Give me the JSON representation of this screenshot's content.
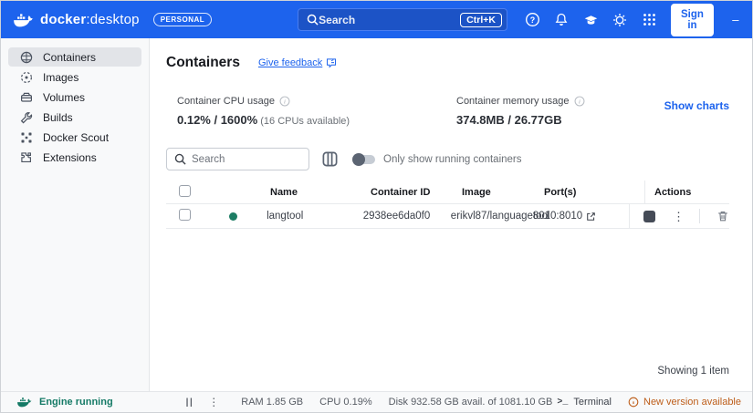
{
  "titlebar": {
    "brand_bold": "docker",
    "brand_sep": ":",
    "brand_light": "desktop",
    "plan_badge": "PERSONAL",
    "search_placeholder": "Search",
    "shortcut": "Ctrl+K",
    "sign_in_label": "Sign in",
    "minimize": "–",
    "close": "✕"
  },
  "sidebar": {
    "items": [
      {
        "label": "Containers"
      },
      {
        "label": "Images"
      },
      {
        "label": "Volumes"
      },
      {
        "label": "Builds"
      },
      {
        "label": "Docker Scout"
      },
      {
        "label": "Extensions"
      }
    ]
  },
  "main": {
    "title": "Containers",
    "feedback_link": "Give feedback",
    "stats": {
      "cpu_label": "Container CPU usage",
      "cpu_value": "0.12% / 1600%",
      "cpu_note": " (16 CPUs available)",
      "mem_label": "Container memory usage",
      "mem_value": "374.8MB / 26.77GB",
      "show_charts": "Show charts"
    },
    "controls": {
      "search_placeholder": "Search",
      "toggle_label": "Only show running containers"
    },
    "table": {
      "headers": [
        "Name",
        "Container ID",
        "Image",
        "Port(s)",
        "Actions"
      ],
      "rows": [
        {
          "name": "langtool",
          "container_id": "2938ee6da0f0",
          "image": "erikvl87/languagetool",
          "ports": "8010:8010",
          "status": "running"
        }
      ]
    },
    "footer": "Showing 1 item"
  },
  "statusbar": {
    "engine_status": "Engine running",
    "pause": "||",
    "ram": "RAM 1.85 GB",
    "cpu": "CPU 0.19%",
    "disk": "Disk 932.58 GB avail. of 1081.10 GB",
    "terminal": "Terminal",
    "terminal_glyph": ">_",
    "update": "New version available"
  },
  "colors": {
    "topbar_blue": "#1d63ed",
    "link_blue": "#1d63ed",
    "running_green": "#1d7d64",
    "engine_green": "#157a66",
    "update_orange": "#bd5d19"
  }
}
